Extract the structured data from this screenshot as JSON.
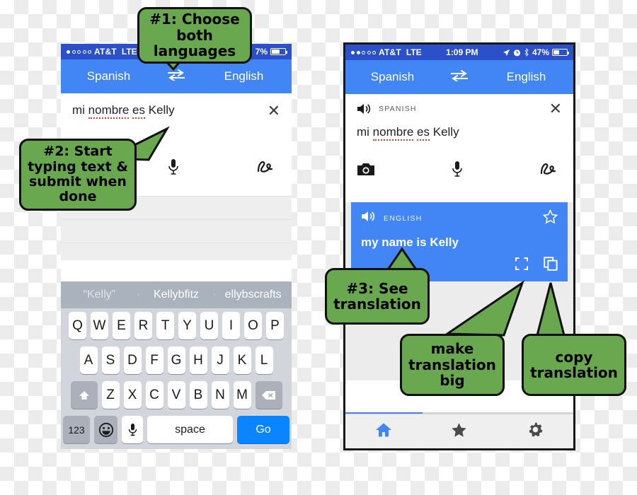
{
  "left_phone": {
    "status": {
      "signal_filled": 1,
      "signal_total": 5,
      "carrier": "AT&T",
      "network": "LTE",
      "time": "",
      "battery_pct": "7%",
      "battery_level": 62
    },
    "lang_bar": {
      "source": "Spanish",
      "swap_icon": "swap-horizontal-icon",
      "target": "English"
    },
    "input": {
      "text": "mi nombre es Kelly",
      "misspelled": [
        "nombre",
        "es"
      ],
      "clear_icon": "close-icon",
      "mic_icon": "microphone-icon",
      "handwriting_icon": "handwriting-icon"
    },
    "keyboard": {
      "suggestions": [
        "“Kelly”",
        "Kellybfitz",
        "ellybscrafts"
      ],
      "row1": [
        "Q",
        "W",
        "E",
        "R",
        "T",
        "Y",
        "U",
        "I",
        "O",
        "P"
      ],
      "row2": [
        "A",
        "S",
        "D",
        "F",
        "G",
        "H",
        "J",
        "K",
        "L"
      ],
      "row3": [
        "Z",
        "X",
        "C",
        "V",
        "B",
        "N",
        "M"
      ],
      "shift_icon": "shift-up-icon",
      "backspace_icon": "backspace-icon",
      "numbers_key": "123",
      "emoji_icon": "smiley-face-icon",
      "mic_icon": "microphone-icon",
      "space_key": "space",
      "go_key": "Go"
    }
  },
  "right_phone": {
    "status": {
      "signal_filled": 2,
      "signal_total": 5,
      "carrier": "AT&T",
      "network": "LTE",
      "time": "1:09 PM",
      "location_icon": "location-arrow-icon",
      "alarm_icon": "alarm-clock-icon",
      "bluetooth_icon": "bluetooth-icon",
      "battery_pct": "47%",
      "battery_level": 47
    },
    "lang_bar": {
      "source": "Spanish",
      "swap_icon": "swap-horizontal-icon",
      "target": "English"
    },
    "source_card": {
      "speaker_icon": "speaker-icon",
      "language_label": "SPANISH",
      "clear_icon": "close-icon",
      "text": "mi nombre es Kelly",
      "camera_icon": "camera-icon",
      "mic_icon": "microphone-icon",
      "handwriting_icon": "handwriting-icon"
    },
    "translation_card": {
      "speaker_icon": "speaker-icon",
      "language_label": "ENGLISH",
      "star_icon": "star-outline-icon",
      "text": "my name is Kelly",
      "fullscreen_icon": "fullscreen-icon",
      "copy_icon": "copy-icon",
      "accent_color": "#4285f4"
    },
    "nav": {
      "home_icon": "home-icon",
      "star_icon": "star-filled-icon",
      "settings_icon": "gear-icon",
      "active": "home",
      "progress_pct": 34
    }
  },
  "callouts": [
    {
      "id": "callout-1",
      "text": "#1: Choose\nboth\nlanguages"
    },
    {
      "id": "callout-2",
      "text": "#2: Start\ntyping text &\nsubmit when\ndone"
    },
    {
      "id": "callout-3",
      "text": "#3: See\ntranslation"
    },
    {
      "id": "callout-make-big",
      "text": "make\ntranslation\nbig"
    },
    {
      "id": "callout-copy",
      "text": "copy\ntranslation"
    }
  ],
  "theme": {
    "callout_fill": "#6aa84f",
    "callout_stroke": "#111111",
    "google_blue": "#4285f4",
    "status_blue": "#2b50c8"
  }
}
